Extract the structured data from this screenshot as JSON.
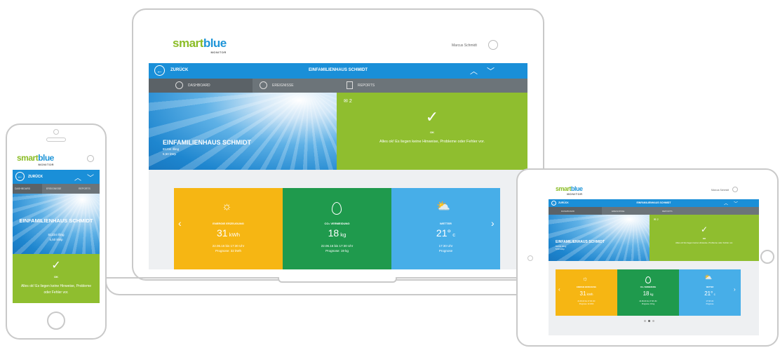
{
  "app": {
    "logo_smart": "smart",
    "logo_blue": "blue",
    "logo_sub": "MONITOR",
    "user_name": "Marcus Schmidt",
    "nav": {
      "back_label": "ZURÜCK",
      "title": "EINFAMILIENHAUS SCHMIDT",
      "up": "︿",
      "down": "﹀"
    },
    "tabs": [
      {
        "label": "DASHBOARD",
        "icon": "clock-icon"
      },
      {
        "label": "EREIGNISSE",
        "icon": "history-icon"
      },
      {
        "label": "REPORTS",
        "icon": "document-icon"
      }
    ],
    "hero": {
      "title": "EINFAMILIENHAUS SCHMIDT",
      "zip_city": "81234 Illing",
      "power": "5,50 kWp"
    },
    "status": {
      "mail_count": "2",
      "check": "✓",
      "ok_label": "OK",
      "message": "Alles ok! Es liegen keine Hinweise, Probleme oder Fehler vor."
    },
    "tiles": [
      {
        "key": "energy",
        "icon": "sun-icon",
        "label": "ENERGIE ERZEUGUNG",
        "value": "31",
        "unit": "kWh",
        "info1": "22.06.16 bis 17:30 Uhr",
        "info2": "Prognose: 32 kWh"
      },
      {
        "key": "co2",
        "icon": "leaf-icon",
        "label": "CO₂ VERMEIDUNG",
        "value": "18",
        "unit": "kg",
        "info1": "22.06.16 bis 17:30 Uhr",
        "info2": "Prognose: 19 kg"
      },
      {
        "key": "weather",
        "icon": "sun-cloud-icon",
        "label": "WETTER",
        "value": "21°",
        "unit": "c",
        "info1": "17:30 Uhr",
        "info2": "Prognose"
      }
    ],
    "carousel": {
      "prev": "‹",
      "next": "›"
    },
    "colors": {
      "blue": "#1a8fd8",
      "green": "#8fbe2f",
      "yellow": "#f6b613",
      "dark_green": "#1f9a4d",
      "light_blue": "#47aee8",
      "grey": "#6c7479"
    }
  }
}
